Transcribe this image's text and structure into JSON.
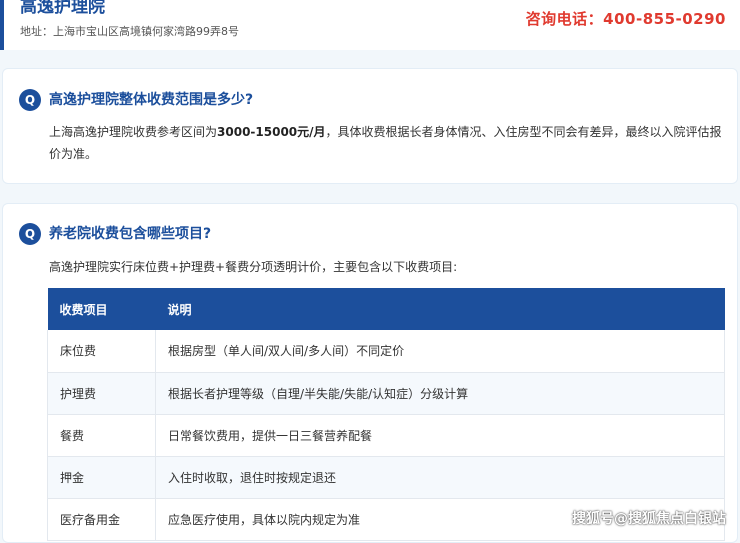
{
  "header": {
    "name": "高逸护理院",
    "address": "地址：上海市宝山区高境镇何家湾路99弄8号",
    "phone": "咨询电话：400-855-0290"
  },
  "faq1": {
    "badge": "Q",
    "question": "高逸护理院整体收费范围是多少?",
    "answer_pre": "上海高逸护理院收费参考区间为",
    "answer_bold": "3000-15000元/月",
    "answer_post": "，具体收费根据长者身体情况、入住房型不同会有差异，最终以入院评估报价为准。"
  },
  "faq2": {
    "badge": "Q",
    "question": "养老院收费包含哪些项目?",
    "intro": "高逸护理院实行床位费+护理费+餐费分项透明计价，主要包含以下收费项目:",
    "table": {
      "headers": [
        "收费项目",
        "说明"
      ],
      "rows": [
        [
          "床位费",
          "根据房型（单人间/双人间/多人间）不同定价"
        ],
        [
          "护理费",
          "根据长者护理等级（自理/半失能/失能/认知症）分级计算"
        ],
        [
          "餐费",
          "日常餐饮费用，提供一日三餐营养配餐"
        ],
        [
          "押金",
          "入住时收取，退住时按规定退还"
        ],
        [
          "医疗备用金",
          "应急医疗使用，具体以院内规定为准"
        ]
      ]
    }
  },
  "watermark": "搜狐号@搜狐焦点白银站",
  "colors": {
    "brand": "#1c4f9c",
    "phone": "#e03a2f"
  }
}
